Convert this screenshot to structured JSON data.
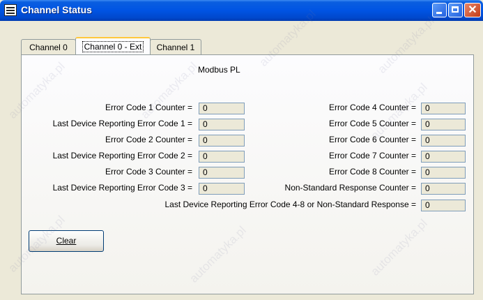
{
  "window": {
    "title": "Channel Status",
    "icon": "app-icon"
  },
  "titlebar_buttons": {
    "minimize": "minimize-icon",
    "maximize": "maximize-icon",
    "close": "close-icon"
  },
  "tabs": [
    {
      "label": "Channel 0",
      "active": false
    },
    {
      "label": "Channel 0 - Ext",
      "active": true
    },
    {
      "label": "Channel 1",
      "active": false
    }
  ],
  "heading": "Modbus PL",
  "left_fields": [
    {
      "label": "Error Code 1 Counter =",
      "value": "0"
    },
    {
      "label": "Last Device Reporting Error Code 1 =",
      "value": "0"
    },
    {
      "label": "Error Code 2 Counter =",
      "value": "0"
    },
    {
      "label": "Last Device Reporting Error Code 2 =",
      "value": "0"
    },
    {
      "label": "Error Code 3 Counter =",
      "value": "0"
    },
    {
      "label": "Last Device Reporting Error Code 3 =",
      "value": "0"
    }
  ],
  "right_fields": [
    {
      "label": "Error Code 4 Counter =",
      "value": "0"
    },
    {
      "label": "Error Code 5 Counter =",
      "value": "0"
    },
    {
      "label": "Error Code 6 Counter =",
      "value": "0"
    },
    {
      "label": "Error Code 7 Counter =",
      "value": "0"
    },
    {
      "label": "Error Code 8 Counter =",
      "value": "0"
    },
    {
      "label": "Non-Standard Response Counter =",
      "value": "0"
    }
  ],
  "bottom_field": {
    "label": "Last Device Reporting Error Code 4-8 or Non-Standard Response =",
    "value": "0"
  },
  "clear_button": {
    "label": "Clear",
    "accesskey": "C"
  },
  "watermark": "automatyka.pl",
  "colors": {
    "titlebar": "#0054e3",
    "tab_highlight": "#ffc83c",
    "close_button": "#c23c17"
  }
}
